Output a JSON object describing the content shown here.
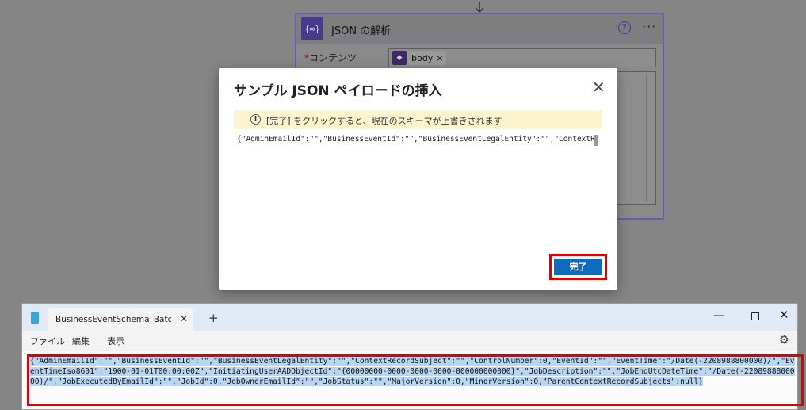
{
  "flow_card": {
    "icon_glyph": "{∞}",
    "title": "JSON の解析",
    "help_glyph": "?",
    "more_glyph": "···",
    "content_label_required": "*",
    "content_label": "コンテンツ",
    "token_label": "body",
    "token_close": "×"
  },
  "dialog": {
    "title": "サンプル JSON ペイロードの挿入",
    "close_glyph": "✕",
    "banner_text": "[完了] をクリックすると、現在のスキーマが上書きされます",
    "info_glyph": "i",
    "json_preview": "{\"AdminEmailId\":\"\",\"BusinessEventId\":\"\",\"BusinessEventLegalEntity\":\"\",\"ContextRecordSubject\":\"\",",
    "done_label": "完了"
  },
  "notepad": {
    "tab_title": "BusinessEventSchema_BatchJobSta",
    "tab_close": "✕",
    "new_tab": "+",
    "minimize": "—",
    "close": "✕",
    "menu": [
      "ファイル",
      "編集",
      "表示"
    ],
    "settings_glyph": "⚙",
    "content": "{\"AdminEmailId\":\"\",\"BusinessEventId\":\"\",\"BusinessEventLegalEntity\":\"\",\"ContextRecordSubject\":\"\",\"ControlNumber\":0,\"EventId\":\"\",\"EventTime\":\"/Date(-2208988800000)/\",\"EventTimeIso8601\":\"1900-01-01T00:00:00Z\",\"InitiatingUserAADObjectId\":\"{00000000-0000-0000-0000-000000000000}\",\"JobDescription\":\"\",\"JobEndUtcDateTime\":\"/Date(-2208988800000)/\",\"JobExecutedByEmailId\":\"\",\"JobId\":0,\"JobOwnerEmailId\":\"\",\"JobStatus\":\"\",\"MajorVersion\":0,\"MinorVersion\":0,\"ParentContextRecordSubjects\":null}"
  }
}
